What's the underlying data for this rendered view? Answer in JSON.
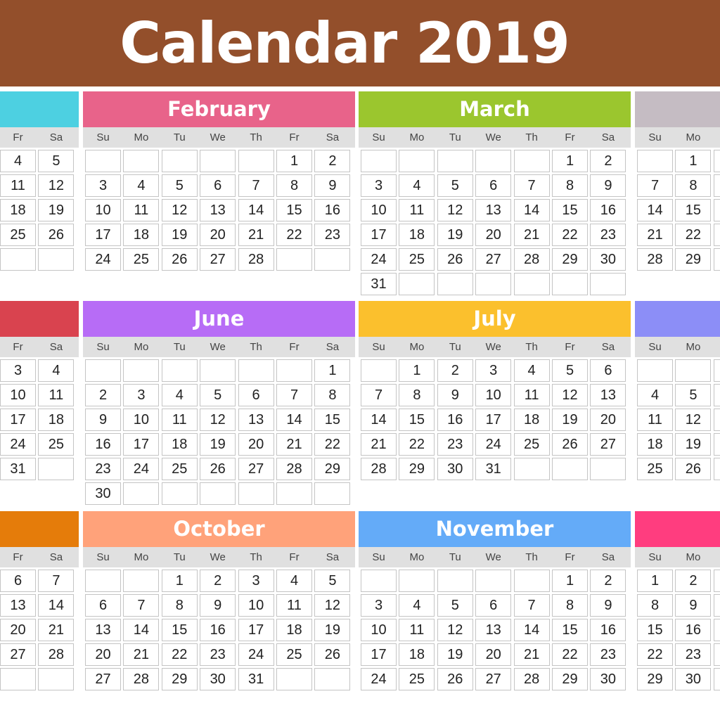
{
  "title": "Calendar 2019",
  "months": [
    {
      "name": "",
      "color": "#4dd0e1",
      "days": [
        "Fr",
        "Sa"
      ],
      "weeks": [
        [
          "4",
          "5"
        ],
        [
          "11",
          "12"
        ],
        [
          "18",
          "19"
        ],
        [
          "25",
          "26"
        ],
        [
          "",
          ""
        ]
      ]
    },
    {
      "name": "February",
      "color": "#e8638a",
      "days": [
        "Su",
        "Mo",
        "Tu",
        "We",
        "Th",
        "Fr",
        "Sa"
      ],
      "weeks": [
        [
          "",
          "",
          "",
          "",
          "",
          "1",
          "2"
        ],
        [
          "3",
          "4",
          "5",
          "6",
          "7",
          "8",
          "9"
        ],
        [
          "10",
          "11",
          "12",
          "13",
          "14",
          "15",
          "16"
        ],
        [
          "17",
          "18",
          "19",
          "20",
          "21",
          "22",
          "23"
        ],
        [
          "24",
          "25",
          "26",
          "27",
          "28",
          "",
          ""
        ]
      ]
    },
    {
      "name": "March",
      "color": "#9bc62e",
      "days": [
        "Su",
        "Mo",
        "Tu",
        "We",
        "Th",
        "Fr",
        "Sa"
      ],
      "weeks": [
        [
          "",
          "",
          "",
          "",
          "",
          "1",
          "2"
        ],
        [
          "3",
          "4",
          "5",
          "6",
          "7",
          "8",
          "9"
        ],
        [
          "10",
          "11",
          "12",
          "13",
          "14",
          "15",
          "16"
        ],
        [
          "17",
          "18",
          "19",
          "20",
          "21",
          "22",
          "23"
        ],
        [
          "24",
          "25",
          "26",
          "27",
          "28",
          "29",
          "30"
        ],
        [
          "31",
          "",
          "",
          "",
          "",
          "",
          ""
        ]
      ]
    },
    {
      "name": "",
      "color": "#c5bcc3",
      "days": [
        "Su",
        "Mo"
      ],
      "weeks": [
        [
          "",
          "1"
        ],
        [
          "7",
          "8"
        ],
        [
          "14",
          "15"
        ],
        [
          "21",
          "22"
        ],
        [
          "28",
          "29"
        ]
      ]
    },
    {
      "name": "",
      "color": "#d9434f",
      "days": [
        "Fr",
        "Sa"
      ],
      "weeks": [
        [
          "3",
          "4"
        ],
        [
          "10",
          "11"
        ],
        [
          "17",
          "18"
        ],
        [
          "24",
          "25"
        ],
        [
          "31",
          ""
        ]
      ]
    },
    {
      "name": "June",
      "color": "#b76cf6",
      "days": [
        "Su",
        "Mo",
        "Tu",
        "We",
        "Th",
        "Fr",
        "Sa"
      ],
      "weeks": [
        [
          "",
          "",
          "",
          "",
          "",
          "",
          "1"
        ],
        [
          "2",
          "3",
          "4",
          "5",
          "6",
          "7",
          "8"
        ],
        [
          "9",
          "10",
          "11",
          "12",
          "13",
          "14",
          "15"
        ],
        [
          "16",
          "17",
          "18",
          "19",
          "20",
          "21",
          "22"
        ],
        [
          "23",
          "24",
          "25",
          "26",
          "27",
          "28",
          "29"
        ],
        [
          "30",
          "",
          "",
          "",
          "",
          "",
          ""
        ]
      ]
    },
    {
      "name": "July",
      "color": "#fbc02d",
      "days": [
        "Su",
        "Mo",
        "Tu",
        "We",
        "Th",
        "Fr",
        "Sa"
      ],
      "weeks": [
        [
          "",
          "1",
          "2",
          "3",
          "4",
          "5",
          "6"
        ],
        [
          "7",
          "8",
          "9",
          "10",
          "11",
          "12",
          "13"
        ],
        [
          "14",
          "15",
          "16",
          "17",
          "18",
          "19",
          "20"
        ],
        [
          "21",
          "22",
          "23",
          "24",
          "25",
          "26",
          "27"
        ],
        [
          "28",
          "29",
          "30",
          "31",
          "",
          "",
          ""
        ]
      ]
    },
    {
      "name": "",
      "color": "#8c8ef7",
      "days": [
        "Su",
        "Mo"
      ],
      "weeks": [
        [
          "",
          ""
        ],
        [
          "4",
          "5"
        ],
        [
          "11",
          "12"
        ],
        [
          "18",
          "19"
        ],
        [
          "25",
          "26"
        ]
      ]
    },
    {
      "name": "",
      "color": "#e57c0a",
      "days": [
        "Fr",
        "Sa"
      ],
      "weeks": [
        [
          "6",
          "7"
        ],
        [
          "13",
          "14"
        ],
        [
          "20",
          "21"
        ],
        [
          "27",
          "28"
        ],
        [
          "",
          ""
        ]
      ]
    },
    {
      "name": "October",
      "color": "#ffa27a",
      "days": [
        "Su",
        "Mo",
        "Tu",
        "We",
        "Th",
        "Fr",
        "Sa"
      ],
      "weeks": [
        [
          "",
          "",
          "1",
          "2",
          "3",
          "4",
          "5"
        ],
        [
          "6",
          "7",
          "8",
          "9",
          "10",
          "11",
          "12"
        ],
        [
          "13",
          "14",
          "15",
          "16",
          "17",
          "18",
          "19"
        ],
        [
          "20",
          "21",
          "22",
          "23",
          "24",
          "25",
          "26"
        ],
        [
          "27",
          "28",
          "29",
          "30",
          "31",
          "",
          ""
        ]
      ]
    },
    {
      "name": "November",
      "color": "#64abf8",
      "days": [
        "Su",
        "Mo",
        "Tu",
        "We",
        "Th",
        "Fr",
        "Sa"
      ],
      "weeks": [
        [
          "",
          "",
          "",
          "",
          "",
          "1",
          "2"
        ],
        [
          "3",
          "4",
          "5",
          "6",
          "7",
          "8",
          "9"
        ],
        [
          "10",
          "11",
          "12",
          "13",
          "14",
          "15",
          "16"
        ],
        [
          "17",
          "18",
          "19",
          "20",
          "21",
          "22",
          "23"
        ],
        [
          "24",
          "25",
          "26",
          "27",
          "28",
          "29",
          "30"
        ]
      ]
    },
    {
      "name": "",
      "color": "#ff3d7f",
      "days": [
        "Su",
        "Mo"
      ],
      "weeks": [
        [
          "1",
          "2"
        ],
        [
          "8",
          "9"
        ],
        [
          "15",
          "16"
        ],
        [
          "22",
          "23"
        ],
        [
          "29",
          "30"
        ]
      ]
    }
  ]
}
